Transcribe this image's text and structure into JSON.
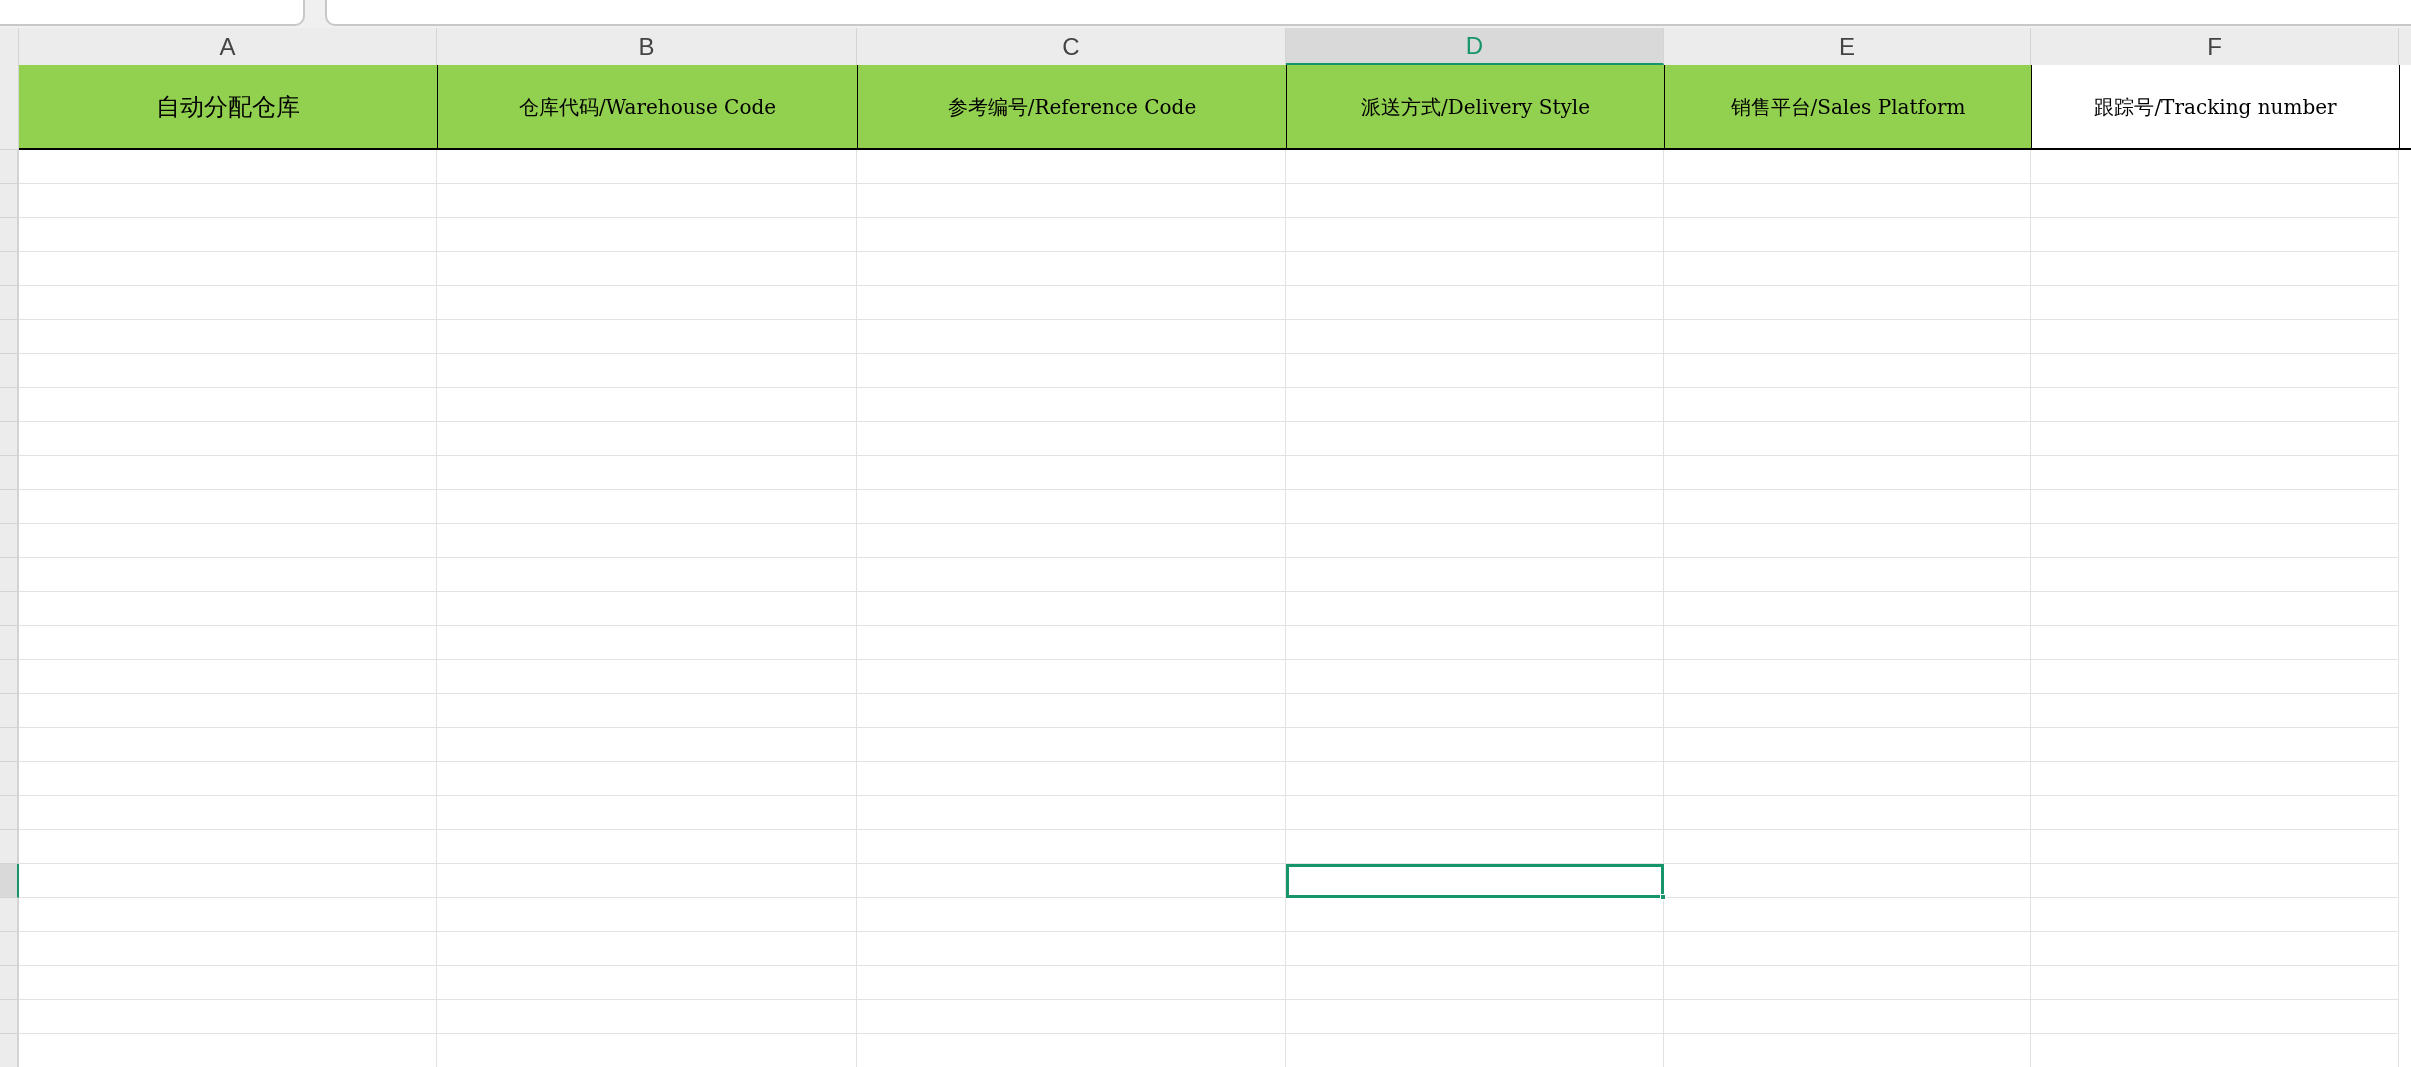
{
  "columns": [
    {
      "letter": "A",
      "selected": false,
      "header": "自动分配仓库",
      "color": "#92d050"
    },
    {
      "letter": "B",
      "selected": false,
      "header": "仓库代码/Warehouse Code",
      "color": "#92d050"
    },
    {
      "letter": "C",
      "selected": false,
      "header": "参考编号/Reference Code",
      "color": "#92d050"
    },
    {
      "letter": "D",
      "selected": true,
      "header": "派送方式/Delivery Style",
      "color": "#92d050"
    },
    {
      "letter": "E",
      "selected": false,
      "header": "销售平台/Sales Platform",
      "color": "#92d050"
    },
    {
      "letter": "F",
      "selected": false,
      "header": "跟踪号/Tracking number",
      "color": "#ffffff"
    }
  ],
  "rows": [
    {
      "selected": false
    },
    {
      "selected": false
    },
    {
      "selected": false
    },
    {
      "selected": false
    },
    {
      "selected": false
    },
    {
      "selected": false
    },
    {
      "selected": false
    },
    {
      "selected": false
    },
    {
      "selected": false
    },
    {
      "selected": false
    },
    {
      "selected": false
    },
    {
      "selected": false
    },
    {
      "selected": false
    },
    {
      "selected": false
    },
    {
      "selected": false
    },
    {
      "selected": false
    },
    {
      "selected": false
    },
    {
      "selected": false
    },
    {
      "selected": false
    },
    {
      "selected": false
    },
    {
      "selected": false
    },
    {
      "selected": true
    },
    {
      "selected": false
    },
    {
      "selected": false
    },
    {
      "selected": false
    },
    {
      "selected": false
    },
    {
      "selected": false
    }
  ]
}
